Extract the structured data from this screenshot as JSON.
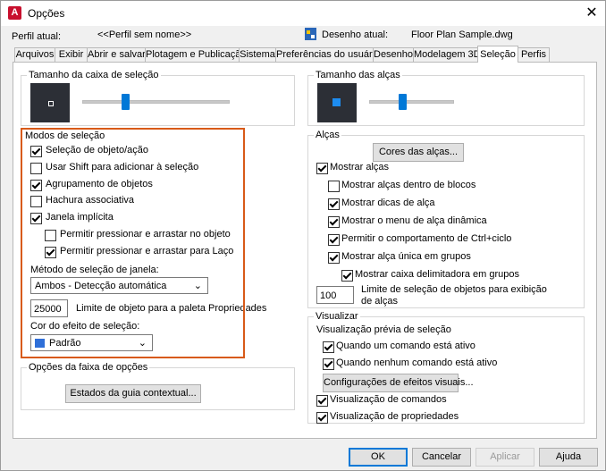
{
  "window": {
    "title": "Opções",
    "app_letter": "A"
  },
  "header": {
    "profile_label": "Perfil atual:",
    "profile_value": "<<Perfil sem nome>>",
    "drawing_label": "Desenho atual:",
    "drawing_value": "Floor Plan Sample.dwg"
  },
  "tabs": [
    {
      "label": "Arquivos"
    },
    {
      "label": "Exibir"
    },
    {
      "label": "Abrir e salvar"
    },
    {
      "label": "Plotagem e Publicação"
    },
    {
      "label": "Sistema"
    },
    {
      "label": "Preferências do usuário"
    },
    {
      "label": "Desenho"
    },
    {
      "label": "Modelagem 3D"
    },
    {
      "label": "Seleção"
    },
    {
      "label": "Perfis"
    }
  ],
  "pickbox": {
    "title": "Tamanho da caixa de seleção",
    "level": 0.28
  },
  "grips_size": {
    "title": "Tamanho das alças",
    "level": 0.38
  },
  "selection_modes": {
    "title": "Modos de seleção",
    "options": [
      {
        "label": "Seleção de objeto/ação",
        "checked": true
      },
      {
        "label": "Usar Shift para adicionar à seleção",
        "checked": false
      },
      {
        "label": "Agrupamento de objetos",
        "checked": true
      },
      {
        "label": "Hachura associativa",
        "checked": false
      },
      {
        "label": "Janela implícita",
        "checked": true
      },
      {
        "label": "Permitir pressionar e arrastar no objeto",
        "checked": false
      },
      {
        "label": "Permitir pressionar e arrastar para Laço",
        "checked": true
      }
    ],
    "window_method_label": "Método de seleção de janela:",
    "window_method_value": "Ambos - Detecção automática",
    "limit_value": "25000",
    "limit_label": "Limite de objeto para a paleta Propriedades",
    "effect_color_label": "Cor do efeito de seleção:",
    "effect_color_value": "Padrão",
    "effect_color_swatch": "#2f6fd8"
  },
  "ribbon": {
    "title": "Opções da faixa de opções",
    "button": "Estados da guia contextual..."
  },
  "grips": {
    "title": "Alças",
    "color_button": "Cores das alças...",
    "options": [
      {
        "label": "Mostrar alças",
        "checked": true
      },
      {
        "label": "Mostrar alças dentro de blocos",
        "checked": false
      },
      {
        "label": "Mostrar dicas de alça",
        "checked": true
      },
      {
        "label": "Mostrar o menu de alça dinâmica",
        "checked": true
      },
      {
        "label": "Permitir o comportamento de Ctrl+ciclo",
        "checked": true
      },
      {
        "label": "Mostrar alça única em grupos",
        "checked": true
      },
      {
        "label": "Mostrar caixa delimitadora em grupos",
        "checked": true
      }
    ],
    "limit_value": "100",
    "limit_label_1": "Limite de seleção de objetos para exibição",
    "limit_label_2": "de alças"
  },
  "preview": {
    "title": "Visualizar",
    "subtitle": "Visualização prévia de seleção",
    "options": [
      {
        "label": "Quando um comando está ativo",
        "checked": true
      },
      {
        "label": "Quando nenhum comando está ativo",
        "checked": true
      }
    ],
    "effects_button": "Configurações de efeitos visuais...",
    "options2": [
      {
        "label": "Visualização de comandos",
        "checked": true
      },
      {
        "label": "Visualização de propriedades",
        "checked": true
      }
    ]
  },
  "footer": {
    "ok": "OK",
    "cancel": "Cancelar",
    "apply": "Aplicar",
    "help": "Ajuda"
  }
}
